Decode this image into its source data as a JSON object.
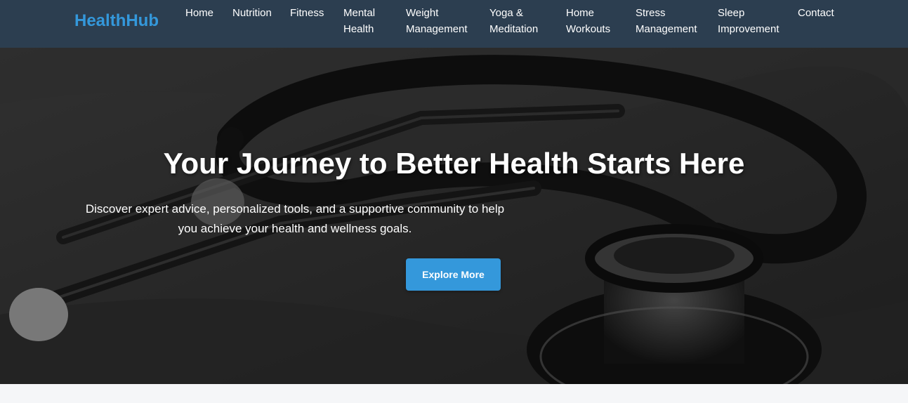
{
  "brand": {
    "name": "HealthHub",
    "color": "#3498db"
  },
  "nav": {
    "background": "#2c3e50",
    "items": [
      {
        "label": "Home"
      },
      {
        "label": "Nutrition"
      },
      {
        "label": "Fitness"
      },
      {
        "label": "Mental\nHealth"
      },
      {
        "label": "Weight\nManagement"
      },
      {
        "label": "Yoga &\nMeditation"
      },
      {
        "label": "Home\nWorkouts"
      },
      {
        "label": "Stress\nManagement"
      },
      {
        "label": "Sleep\nImprovement"
      },
      {
        "label": "Contact"
      }
    ]
  },
  "hero": {
    "image": "stethoscope-photo",
    "title": "Your Journey to Better Health Starts Here",
    "subtitle": "Discover expert advice, personalized tools, and a supportive community to help you achieve your health and wellness goals.",
    "cta_label": "Explore More",
    "cta_color": "#3498db"
  }
}
